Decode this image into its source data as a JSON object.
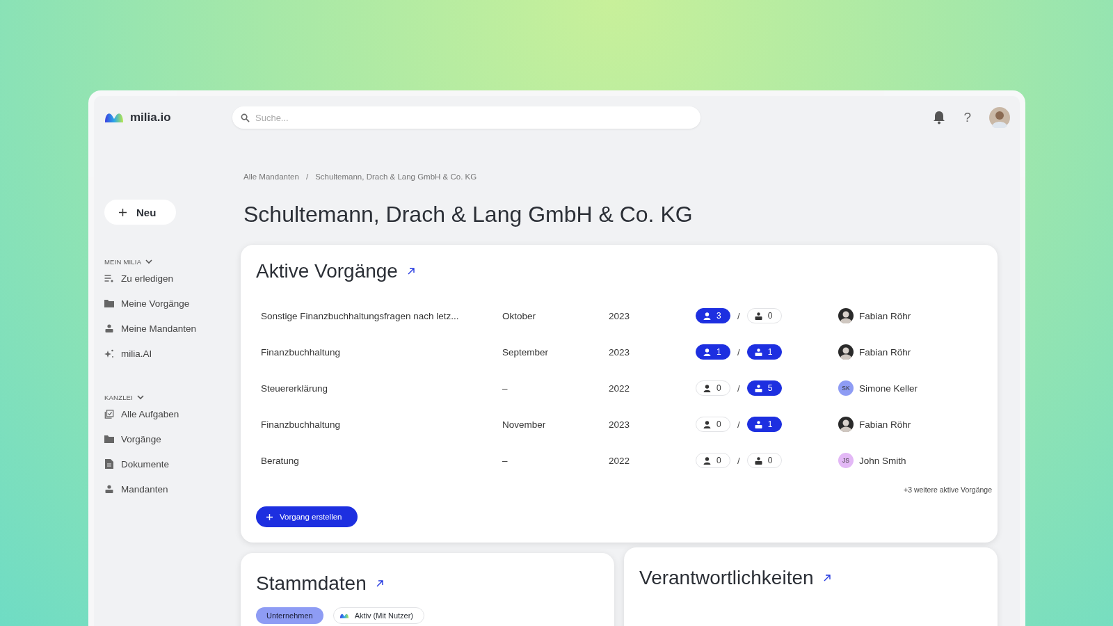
{
  "header": {
    "logo": "milia.io",
    "search": {
      "placeholder": "Suche..."
    },
    "help": "?"
  },
  "sidebar": {
    "new_button": "Neu",
    "sections": [
      {
        "title": "MEIN MILIA",
        "expanded": true,
        "items": [
          {
            "label": "Zu erledigen",
            "kind": "todo"
          },
          {
            "label": "Meine Vorgänge",
            "kind": "folder"
          },
          {
            "label": "Meine Mandanten",
            "kind": "people"
          },
          {
            "label": "milia.AI",
            "kind": "sparkle"
          }
        ]
      },
      {
        "title": "KANZLEI",
        "expanded": true,
        "items": [
          {
            "label": "Alle Aufgaben",
            "kind": "tasks"
          },
          {
            "label": "Vorgänge",
            "kind": "folder"
          },
          {
            "label": "Dokumente",
            "kind": "document"
          },
          {
            "label": "Mandanten",
            "kind": "people"
          }
        ]
      }
    ]
  },
  "breadcrumb": {
    "items": [
      "Alle Mandanten",
      "Schultemann, Drach & Lang GmbH & Co. KG"
    ],
    "separator": "/"
  },
  "page_title": "Schultemann, Drach & Lang GmbH & Co. KG",
  "active_processes": {
    "title": "Aktive Vorgänge",
    "rows": [
      {
        "name": "Sonstige Finanzbuchhaltungsfragen nach letz...",
        "month": "Oktober",
        "year": "2023",
        "users": {
          "count": "3",
          "active": true
        },
        "separator": "/",
        "clients": {
          "count": "0",
          "active": false
        },
        "assignee": {
          "name": "Fabian Röhr",
          "kind": "photo"
        }
      },
      {
        "name": "Finanzbuchhaltung",
        "month": "September",
        "year": "2023",
        "users": {
          "count": "1",
          "active": true
        },
        "separator": "/",
        "clients": {
          "count": "1",
          "active": true
        },
        "assignee": {
          "name": "Fabian Röhr",
          "kind": "photo"
        }
      },
      {
        "name": "Steuererklärung",
        "month": "–",
        "year": "2022",
        "users": {
          "count": "0",
          "active": false
        },
        "separator": "/",
        "clients": {
          "count": "5",
          "active": true
        },
        "assignee": {
          "name": "Simone Keller",
          "kind": "initials",
          "initials": "SK",
          "color": "#8e9cf4"
        }
      },
      {
        "name": "Finanzbuchhaltung",
        "month": "November",
        "year": "2023",
        "users": {
          "count": "0",
          "active": false
        },
        "separator": "/",
        "clients": {
          "count": "1",
          "active": true
        },
        "assignee": {
          "name": "Fabian Röhr",
          "kind": "photo"
        }
      },
      {
        "name": "Beratung",
        "month": "–",
        "year": "2022",
        "users": {
          "count": "0",
          "active": false
        },
        "separator": "/",
        "clients": {
          "count": "0",
          "active": false
        },
        "assignee": {
          "name": "John Smith",
          "kind": "initials",
          "initials": "JS",
          "color": "#e3b8f6"
        }
      }
    ],
    "more": "+3 weitere aktive Vorgänge",
    "create_button": "Vorgang erstellen"
  },
  "master_data": {
    "title": "Stammdaten",
    "tags": [
      {
        "label": "Unternehmen",
        "kind": "filled"
      },
      {
        "label": "Aktiv (Mit Nutzer)",
        "kind": "logo"
      }
    ]
  },
  "responsibilities": {
    "title": "Verantwortlichkeiten"
  }
}
